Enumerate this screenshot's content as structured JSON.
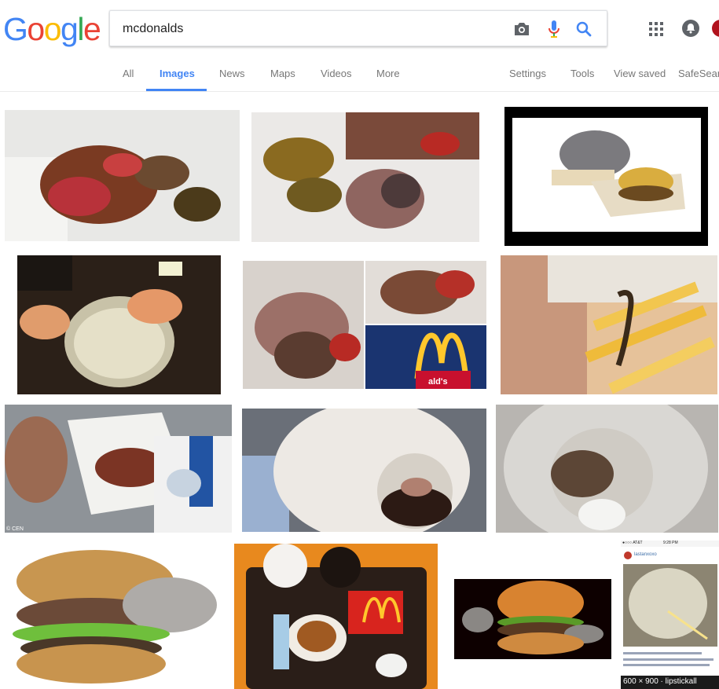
{
  "logo": {
    "letters": [
      "G",
      "o",
      "o",
      "g",
      "l",
      "e"
    ],
    "colors": [
      "#4285f4",
      "#ea4335",
      "#fbbc05",
      "#4285f4",
      "#34a853",
      "#ea4335"
    ]
  },
  "search": {
    "query": "mcdonalds"
  },
  "tabs": {
    "all": "All",
    "images": "Images",
    "news": "News",
    "maps": "Maps",
    "videos": "Videos",
    "more": "More",
    "settings": "Settings",
    "tools": "Tools",
    "view_saved": "View saved",
    "safesearch": "SafeSear"
  },
  "colors": {
    "accent": "#4285f4",
    "tab_text": "#777777"
  },
  "results": {
    "r1_caption": "© CEN",
    "r2_sign": "ald's",
    "r3_status": "●○○○ AT&T",
    "r3_time": "9:28 PM",
    "r3_user": "lastanxoxo",
    "r3_size": "600 × 900 · lipstickall"
  }
}
